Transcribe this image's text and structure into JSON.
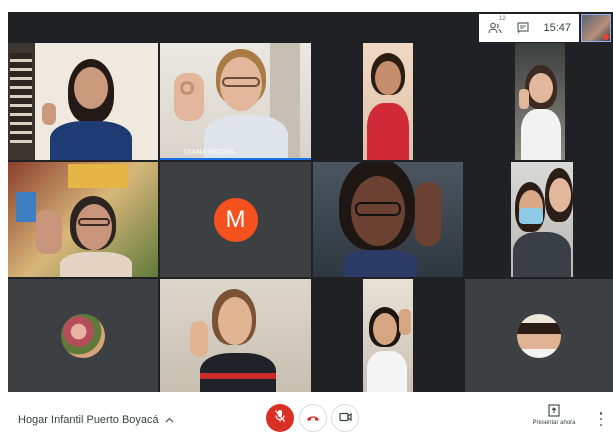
{
  "status": {
    "participant_count": "12",
    "time": "15:47"
  },
  "participants": [
    {
      "name": ""
    },
    {
      "name": "DIANA ROCHA"
    },
    {
      "name": ""
    },
    {
      "name": ""
    },
    {
      "name": ""
    },
    {
      "name": "",
      "initial": "M"
    },
    {
      "name": ""
    },
    {
      "name": ""
    },
    {
      "name": ""
    },
    {
      "name": ""
    },
    {
      "name": ""
    },
    {
      "name": ""
    }
  ],
  "bottombar": {
    "meeting_name": "Hogar Infantil Puerto Boyacá",
    "present_label": "Presentar ahora"
  },
  "icons": {
    "people": "people-icon",
    "chat": "chat-icon",
    "mic_off": "mic-off-icon",
    "hangup": "hangup-icon",
    "camera": "camera-icon",
    "present": "present-screen-icon",
    "more": "more-vert-icon",
    "chevron": "chevron-up-icon"
  },
  "colors": {
    "stage_bg": "#202124",
    "mic_off_red": "#d93025",
    "avatar_orange": "#f4511e",
    "speaker_blue": "#1a73e8"
  }
}
